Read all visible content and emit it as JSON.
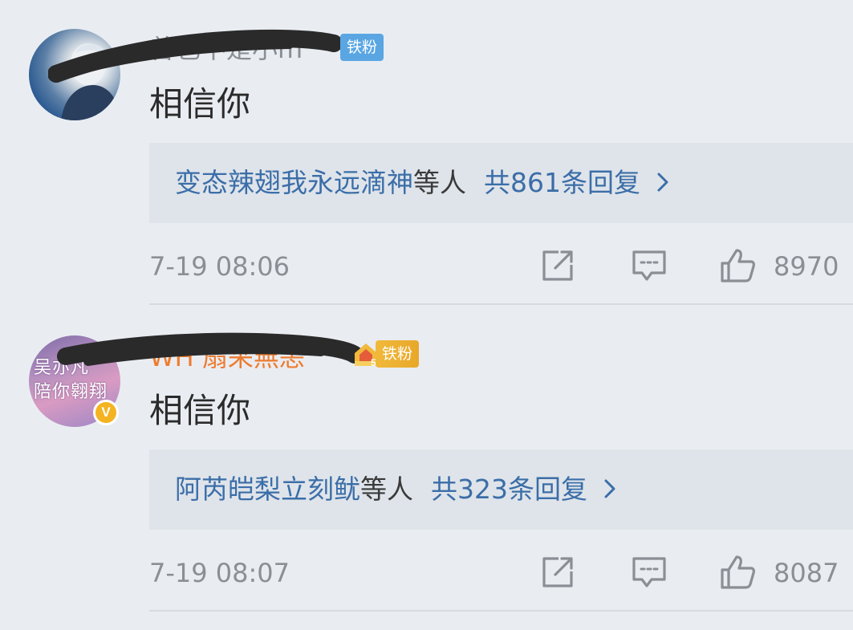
{
  "comments": [
    {
      "username": "曾也不是小m",
      "fan_badge": "铁粉",
      "text": "相信你",
      "reply_preview": {
        "users": "变态辣翅我永远滴神",
        "suffix": "等人",
        "count_label": "共861条回复"
      },
      "timestamp": "7-19 08:06",
      "likes": "8970"
    },
    {
      "username": "WH 扇采無恙",
      "avatar_text": "吴亦凡 陪你翱翔",
      "fan_badge": "铁粉",
      "text": "相信你",
      "reply_preview": {
        "users": "阿芮皑梨立刻鱿",
        "suffix": "等人",
        "count_label": "共323条回复"
      },
      "timestamp": "7-19 08:07",
      "likes": "8087"
    }
  ],
  "colors": {
    "background": "#e9edf2",
    "reply_box": "#dfe4ea",
    "link_blue": "#3b6ea8",
    "meta_gray": "#8b8f95",
    "badge_blue": "#5aa6e3",
    "badge_gold": "#f1b93b",
    "username_orange": "#ee7c2f",
    "redaction": "#2a2a2a"
  },
  "icons": {
    "share": "share-icon",
    "reply": "comment-icon",
    "like": "thumbs-up-icon",
    "chevron": "chevron-right-icon",
    "verified": "verified-v-icon"
  }
}
